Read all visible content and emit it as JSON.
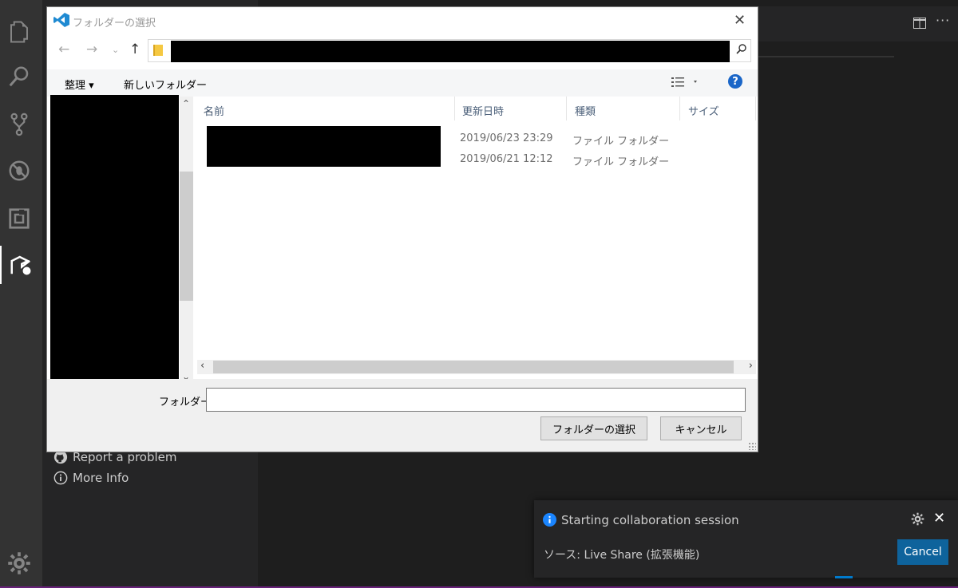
{
  "dialog": {
    "title": "フォルダーの選択",
    "organize_label": "整理 ▾",
    "new_folder_label": "新しいフォルダー",
    "columns": [
      "名前",
      "更新日時",
      "種類",
      "サイズ"
    ],
    "rows": [
      {
        "modified": "2019/06/23 23:29",
        "type": "ファイル フォルダー"
      },
      {
        "modified": "2019/06/21 12:12",
        "type": "ファイル フォルダー"
      }
    ],
    "folder_label": "フォルダー:",
    "folder_value": "",
    "select_button": "フォルダーの選択",
    "cancel_button": "キャンセル",
    "help": "?"
  },
  "sidebar": {
    "report_problem": "Report a problem",
    "more_info": "More Info"
  },
  "notification": {
    "message": "Starting collaboration session",
    "source": "ソース: Live Share (拡張機能)",
    "cancel_label": "Cancel"
  },
  "colors": {
    "activity_bar": "#333333",
    "sidebar": "#252526",
    "editor": "#1e1e1e",
    "accent": "#0e639c",
    "dialog_bg": "#ffffff"
  }
}
